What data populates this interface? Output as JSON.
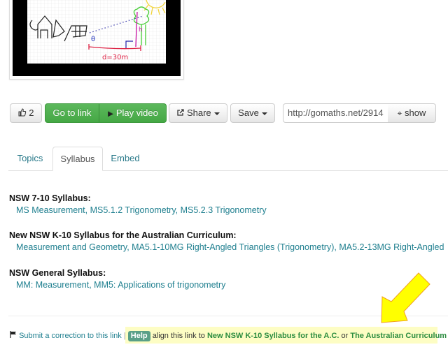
{
  "thumbnail": {
    "alt": "Hand-drawn trigonometry sketch: house, tree, sun, angle theta, d = 30m, h",
    "drawing_label_distance": "d=30m",
    "drawing_label_height": "h",
    "drawing_label_angle": "θ"
  },
  "toolbar": {
    "like_icon": "thumbs-up-icon",
    "like_count": "2",
    "go_to_link_label": "Go to link",
    "play_video_label": "Play video",
    "play_icon": "play-icon",
    "share_label": "Share",
    "share_icon": "share-icon",
    "save_label": "Save",
    "url_value": "http://gomaths.net/2914",
    "show_icon": "expand-icon",
    "show_label": "show"
  },
  "tabs": [
    {
      "label": "Topics",
      "active": false
    },
    {
      "label": "Syllabus",
      "active": true
    },
    {
      "label": "Embed",
      "active": false
    }
  ],
  "syllabus": [
    {
      "title": "NSW 7-10 Syllabus:",
      "links": [
        "MS Measurement",
        "MS5.1.2 Trigonometry",
        "MS5.2.3 Trigonometry"
      ]
    },
    {
      "title": "New NSW K-10 Syllabus for the Australian Curriculum:",
      "links": [
        "Measurement and Geometry",
        "MA5.1-10MG Right-Angled Triangles (Trigonometry)",
        "MA5.2-13MG Right-Angled"
      ]
    },
    {
      "title": "NSW General Syllabus:",
      "links": [
        "MM: Measurement",
        "MM5: Applications of trigonometry"
      ]
    }
  ],
  "footer": {
    "flag_icon": "flag-icon",
    "correction_link": "Submit a correction to this link",
    "separator": "|",
    "help_badge": "Help",
    "align_text": "align this link to",
    "link_k10": "New NSW K-10 Syllabus for the A.C.",
    "or_text": "or",
    "link_ac": "The Australian Curriculum"
  },
  "colors": {
    "link": "#1f7f8f",
    "green_button": "#5cb85c",
    "highlight": "#fdfdc4",
    "arrow": "#ffff00"
  }
}
